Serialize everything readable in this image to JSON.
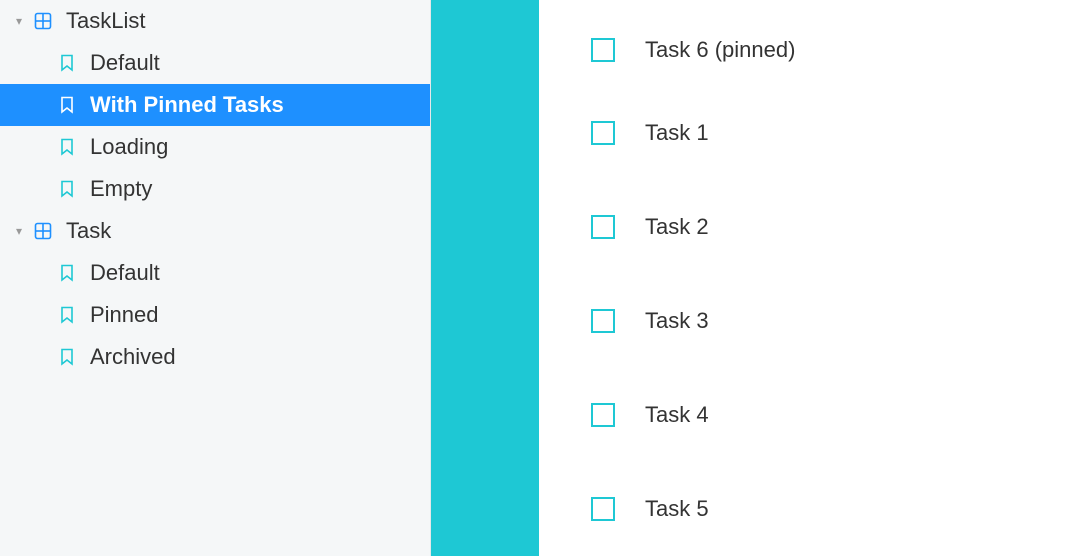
{
  "sidebar": {
    "groups": [
      {
        "label": "TaskList",
        "expanded": true,
        "children": [
          {
            "label": "Default",
            "selected": false
          },
          {
            "label": "With Pinned Tasks",
            "selected": true
          },
          {
            "label": "Loading",
            "selected": false
          },
          {
            "label": "Empty",
            "selected": false
          }
        ]
      },
      {
        "label": "Task",
        "expanded": true,
        "children": [
          {
            "label": "Default",
            "selected": false
          },
          {
            "label": "Pinned",
            "selected": false
          },
          {
            "label": "Archived",
            "selected": false
          }
        ]
      }
    ]
  },
  "preview": {
    "tasks": [
      {
        "label": "Task 6 (pinned)",
        "checked": false
      },
      {
        "label": "Task 1",
        "checked": false
      },
      {
        "label": "Task 2",
        "checked": false
      },
      {
        "label": "Task 3",
        "checked": false
      },
      {
        "label": "Task 4",
        "checked": false
      },
      {
        "label": "Task 5",
        "checked": false
      }
    ]
  },
  "colors": {
    "accent": "#1ec8d4",
    "selection": "#1e90ff"
  }
}
